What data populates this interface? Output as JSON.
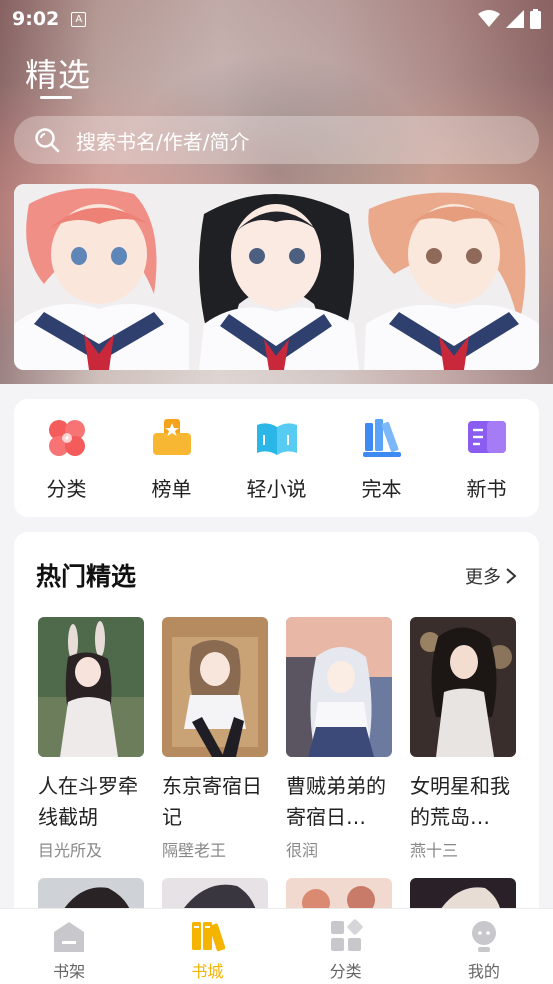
{
  "status_bar": {
    "time": "9:02",
    "notification_glyph": "A"
  },
  "header": {
    "title": "精选"
  },
  "search": {
    "placeholder": "搜索书名/作者/简介"
  },
  "categories": [
    {
      "label": "分类",
      "icon": "clover-icon",
      "color": "#f45b5b"
    },
    {
      "label": "榜单",
      "icon": "trophy-icon",
      "color": "#f7a21b"
    },
    {
      "label": "轻小说",
      "icon": "open-book-icon",
      "color": "#2bb6e8"
    },
    {
      "label": "完本",
      "icon": "bookshelf-icon",
      "color": "#3d8bf2"
    },
    {
      "label": "新书",
      "icon": "new-book-icon",
      "color": "#8a5cf0"
    }
  ],
  "hot": {
    "title": "热门精选",
    "more_label": "更多",
    "books": [
      {
        "title": "人在斗罗牵线截胡",
        "author": "目光所及"
      },
      {
        "title": "东京寄宿日记",
        "author": "隔壁老王"
      },
      {
        "title": "曹贼弟弟的寄宿日…",
        "author": "很润"
      },
      {
        "title": "女明星和我的荒岛…",
        "author": "燕十三"
      }
    ]
  },
  "nav": {
    "active": "书城",
    "items": [
      {
        "label": "书架",
        "icon": "bookshelf-home-icon"
      },
      {
        "label": "书城",
        "icon": "bookstore-icon"
      },
      {
        "label": "分类",
        "icon": "category-grid-icon"
      },
      {
        "label": "我的",
        "icon": "profile-icon"
      }
    ]
  },
  "colors": {
    "accent": "#f4b400",
    "nav_inactive": "#c8c8cc"
  }
}
